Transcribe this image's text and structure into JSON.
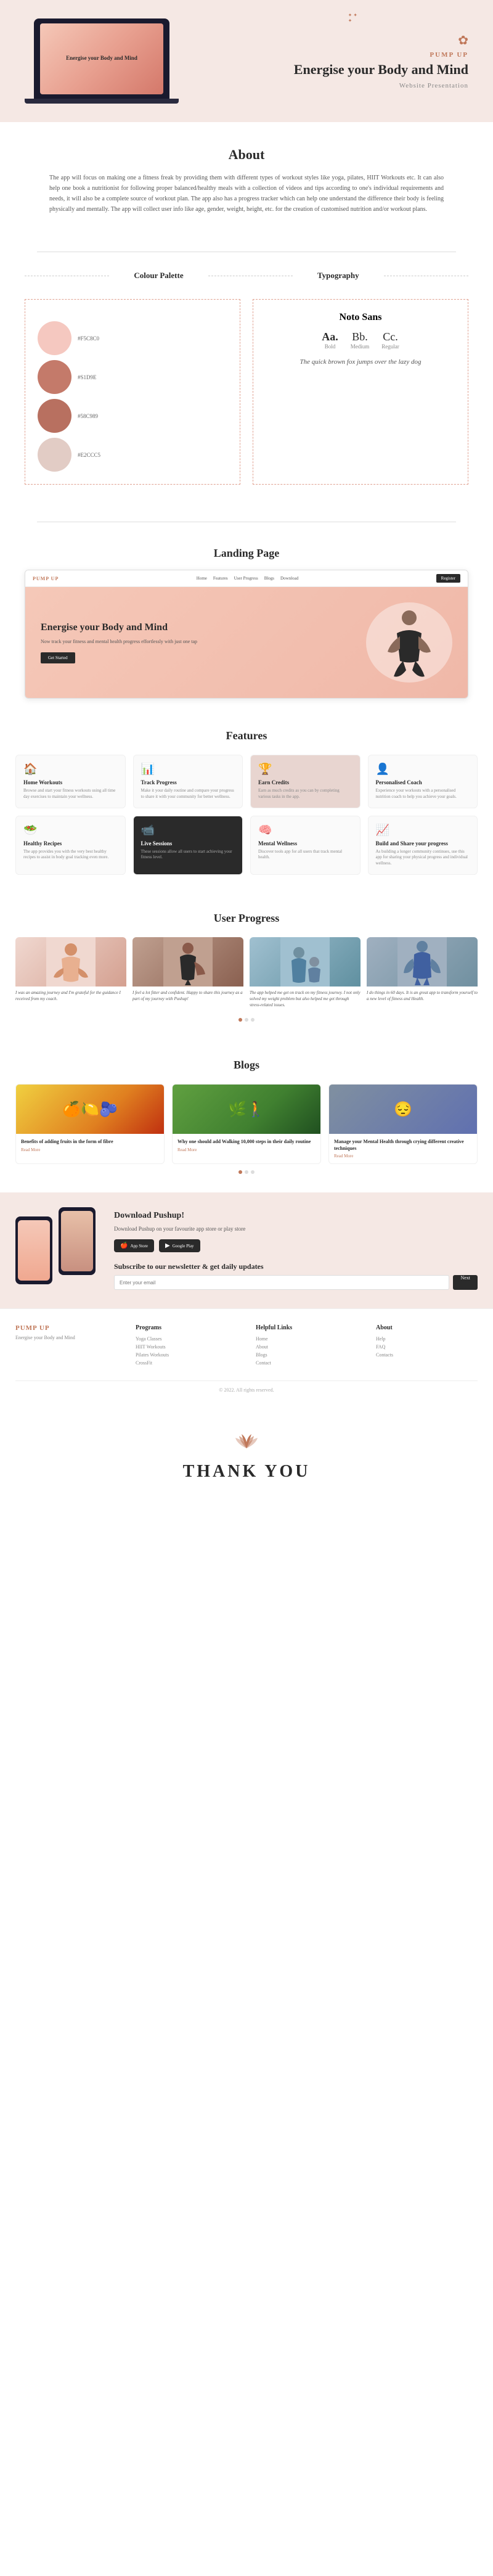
{
  "hero": {
    "logo": "PUMP UP",
    "title": "Energise your Body and Mind",
    "subtitle": "Website Presentation",
    "laptop_text": "Energise your Body and Mind"
  },
  "about": {
    "title": "About",
    "text": "The app will focus on making one a fitness freak by providing them with different types of workout styles like yoga, pilates, HIIT Workouts etc. It can also help one book a nutritionist for following proper balanced/healthy meals with a collection of videos and tips according to one's individual requirements and needs, it will also be a complete source of workout plan. The app also has a progress tracker which can help one understand the difference their body is feeling physically and mentally. The app will collect user info like age, gender, weight, height, etc. for the creation of customised nutrition and/or workout plans."
  },
  "colour_palette": {
    "title": "Colour Palette",
    "colors": [
      {
        "hex": "#F5C8C0",
        "label": "#F5C8C0"
      },
      {
        "hex": "#S1D9E",
        "label": "#S1D9E"
      },
      {
        "hex": "#58C989",
        "label": "#58C989"
      },
      {
        "hex": "#E2CCC5",
        "label": "#E2CCC5"
      }
    ],
    "swatches": [
      {
        "color": "#F5C8C0",
        "label": "#F5C8C0"
      },
      {
        "color": "#c17a6a",
        "label": "#S1D9E"
      },
      {
        "color": "#b87060",
        "label": "#58C989"
      },
      {
        "color": "#E2CCC5",
        "label": "#E2CCC5"
      }
    ]
  },
  "typography": {
    "title": "Typography",
    "font_name": "Noto Sans",
    "weights": [
      {
        "sample": "Aa.",
        "weight": "Bold"
      },
      {
        "sample": "Bb.",
        "weight": "Medium"
      },
      {
        "sample": "Cc.",
        "weight": "Regular"
      }
    ],
    "sample_text": "The quick brown fox jumps over the lazy dog"
  },
  "landing_page": {
    "title": "Landing Page",
    "nav": {
      "brand": "PUMP UP",
      "links": [
        "Home",
        "Features",
        "User Progress",
        "Blogs",
        "Download"
      ],
      "register": "Register"
    },
    "hero": {
      "title": "Energise your Body and Mind",
      "subtitle": "Now track your fitness and mental health progress effortlessly with just one tap",
      "cta": "Get Started"
    }
  },
  "features": {
    "title": "Features",
    "items": [
      {
        "icon": "🏠",
        "title": "Home Workouts",
        "desc": "Browse and start your fitness workouts using all time day exercises to maintain your wellness."
      },
      {
        "icon": "📊",
        "title": "Track Progress",
        "desc": "Make it your daily routine and compare your progress to share it with your community for better wellness."
      },
      {
        "icon": "🏆",
        "title": "Earn Credits",
        "desc": "Earn as much credits as you can by completing various tasks in the app."
      },
      {
        "icon": "👤",
        "title": "Personalised Coach",
        "desc": "Experience your workouts with a personalised nutrition coach to help you achieve your goals."
      },
      {
        "icon": "🥗",
        "title": "Healthy Recipes",
        "desc": "The app provides you with the very best healthy recipes to assist in body goal tracking even more."
      },
      {
        "icon": "📹",
        "title": "Live Sessions",
        "desc": "These sessions allow all users to start achieving your fitness level."
      },
      {
        "icon": "🧠",
        "title": "Mental Wellness",
        "desc": "Discover tools app for all users that track mental health."
      },
      {
        "icon": "📈",
        "title": "Build and Share your progress",
        "desc": "As building a longer community continues, use this app for sharing your physical progress and individual wellness."
      }
    ]
  },
  "user_progress": {
    "title": "User Progress",
    "testimonials": [
      {
        "quote": "I was an amazing journey and I'm grateful for the guidance I received from my coach."
      },
      {
        "quote": "I feel a lot fitter and confident. Happy to share this journey as a part of my journey with Pushup!"
      },
      {
        "quote": "The app helped me get on track on my fitness journey. I not only solved my weight problem but also helped me get through stress-related issues."
      },
      {
        "quote": "I do things in 60 days. It is an great app to transform yourself to a new level of fitness and Health."
      }
    ]
  },
  "blogs": {
    "title": "Blogs",
    "posts": [
      {
        "title": "Benefits of adding fruits in the form of fibre",
        "read_more": "Read More"
      },
      {
        "title": "Why one should add Walking 10,000 steps in their daily routine",
        "read_more": "Read More"
      },
      {
        "title": "Manage your Mental Health through crying different creative techniques",
        "read_more": "Read More"
      }
    ]
  },
  "download": {
    "title": "Download Pushup!",
    "subtitle": "Download Pushup on your favourite app store or play store",
    "app_store": "App Store",
    "google_play": "Google Play",
    "newsletter_title": "Subscribe to our newsletter & get daily updates",
    "newsletter_placeholder": "",
    "newsletter_btn": "Next"
  },
  "footer": {
    "logo": "PUMP UP",
    "tagline": "Energise your Body and Mind",
    "copyright": "© 2022. All rights reserved.",
    "columns": [
      {
        "title": "Programs",
        "links": [
          "Yoga Classes",
          "HIIT Workouts",
          "Pilates Workouts",
          "CrossFit"
        ]
      },
      {
        "title": "Helpful Links",
        "links": [
          "Home",
          "About",
          "Blogs",
          "Contact"
        ]
      },
      {
        "title": "About",
        "links": [
          "Help",
          "FAQ",
          "Contacts"
        ]
      }
    ]
  },
  "thankyou": {
    "text": "THANK YOU"
  }
}
